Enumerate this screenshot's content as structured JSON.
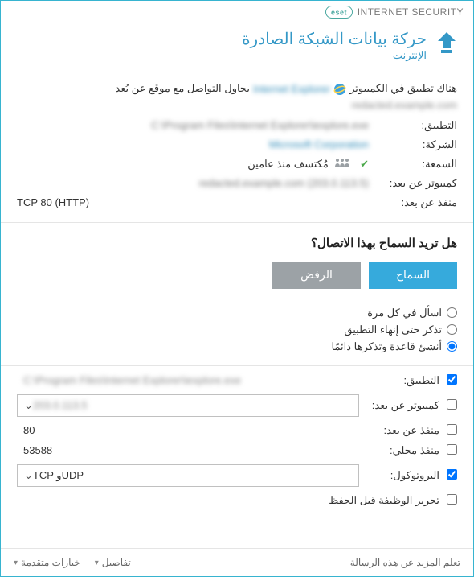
{
  "brand": {
    "name": "INTERNET SECURITY",
    "logo_text": "eset"
  },
  "title": "حركة بيانات الشبكة الصادرة",
  "subtitle": "الإنترنت",
  "message": {
    "prefix": "هناك تطبيق في الكمبيوتر",
    "app_name_blurred": "Internet Explorer",
    "middle": "يحاول التواصل مع موقع عن بُعد",
    "site_blurred": "redacted.example.com"
  },
  "info": {
    "app_label": "التطبيق:",
    "app_value_blurred": "C:\\Program Files\\Internet Explorer\\iexplore.exe",
    "company_label": "الشركة:",
    "company_value_blurred": "Microsoft Corporation",
    "reputation_label": "السمعة:",
    "reputation_value": "مُكتشف منذ عامين",
    "remote_pc_label": "كمبيوتر عن بعد:",
    "remote_pc_value_blurred": "redacted.example.com (203.0.113.5)",
    "remote_port_label": "منفذ عن بعد:",
    "remote_port_value": "TCP 80 (HTTP)"
  },
  "question": "هل تريد السماح بهذا الاتصال؟",
  "buttons": {
    "allow": "السماح",
    "deny": "الرفض"
  },
  "radios": {
    "ask": "اسأل في كل مرة",
    "remember": "تذكر حتى إنهاء التطبيق",
    "create_rule": "أنشئ قاعدة وتذكرها دائمًا"
  },
  "rule": {
    "app_label": "التطبيق:",
    "app_value_blurred": "C:\\Program Files\\Internet Explorer\\iexplore.exe",
    "remote_pc_label": "كمبيوتر عن بعد:",
    "remote_pc_value_blurred": "203.0.113.5",
    "remote_port_label": "منفذ عن بعد:",
    "remote_port_value": "80",
    "local_port_label": "منفذ محلي:",
    "local_port_value": "53588",
    "protocol_label": "البروتوكول:",
    "protocol_value": "TCP وUDP",
    "edit_before_save": "تحرير الوظيفة قبل الحفظ"
  },
  "footer": {
    "learn_more": "تعلم المزيد عن هذه الرسالة",
    "details": "تفاصيل",
    "advanced": "خيارات متقدمة"
  }
}
